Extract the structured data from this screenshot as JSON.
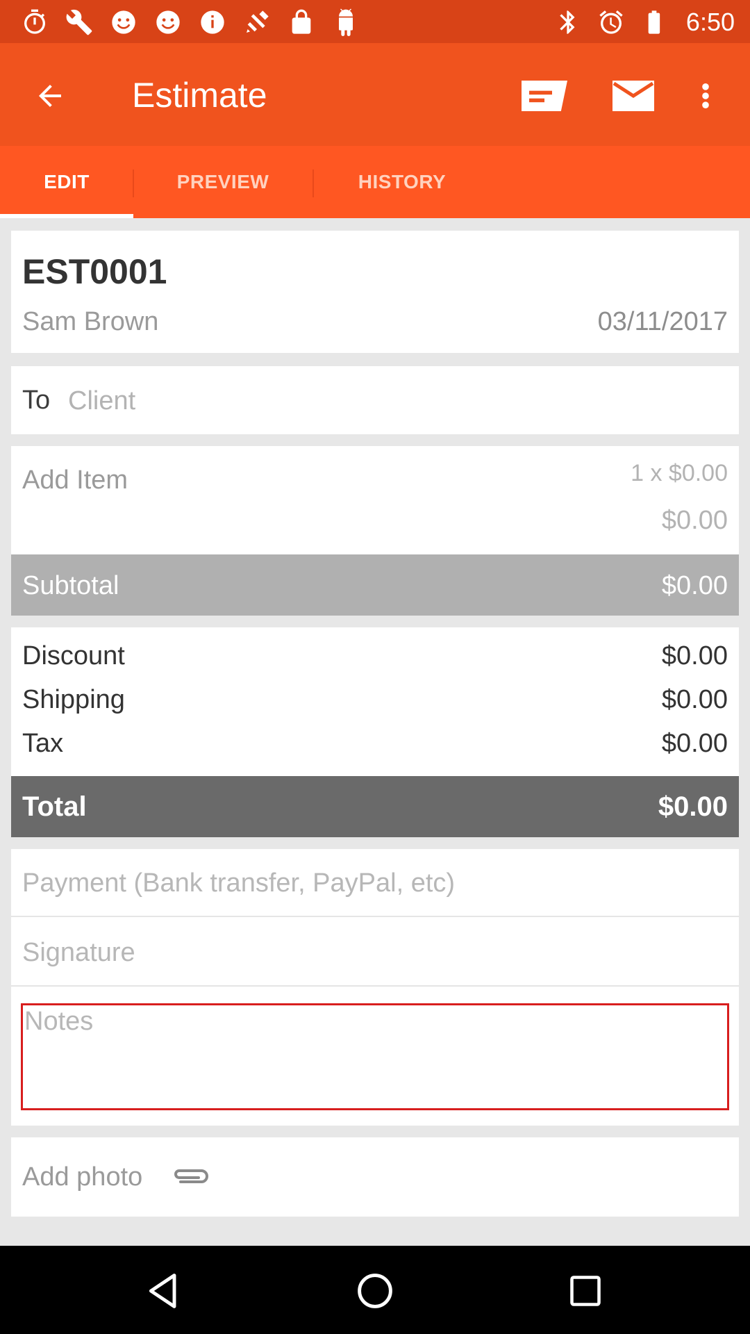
{
  "status_bar": {
    "time": "6:50",
    "left_icons": [
      "stopwatch-icon",
      "wrench-icon",
      "smiley-icon",
      "smiley-icon",
      "info-icon",
      "satellite-icon",
      "lock-icon",
      "android-icon"
    ],
    "right_icons": [
      "bluetooth-icon",
      "alarm-icon",
      "battery-icon"
    ]
  },
  "app_bar": {
    "title": "Estimate",
    "actions": [
      "document-icon",
      "mail-icon",
      "more-vert-icon"
    ]
  },
  "tabs": [
    {
      "label": "EDIT",
      "active": true
    },
    {
      "label": "PREVIEW",
      "active": false
    },
    {
      "label": "HISTORY",
      "active": false
    }
  ],
  "estimate": {
    "number": "EST0001",
    "name": "Sam Brown",
    "date": "03/11/2017"
  },
  "recipient": {
    "label": "To",
    "placeholder": "Client"
  },
  "item": {
    "label": "Add Item",
    "quantity_price": "1 x $0.00",
    "amount": "$0.00"
  },
  "subtotal": {
    "label": "Subtotal",
    "value": "$0.00"
  },
  "adjustments": [
    {
      "label": "Discount",
      "value": "$0.00"
    },
    {
      "label": "Shipping",
      "value": "$0.00"
    },
    {
      "label": "Tax",
      "value": "$0.00"
    }
  ],
  "total": {
    "label": "Total",
    "value": "$0.00"
  },
  "fields": {
    "payment_placeholder": "Payment (Bank transfer, PayPal, etc)",
    "signature_placeholder": "Signature",
    "notes_placeholder": "Notes"
  },
  "add_photo": {
    "label": "Add photo"
  },
  "colors": {
    "status_bar": "#d84317",
    "app_bar": "#f0531e",
    "tabs": "#ff5722",
    "subtotal_bar": "#b0b0b0",
    "total_bar": "#6a6a6a",
    "notes_border": "#d81e1e"
  }
}
